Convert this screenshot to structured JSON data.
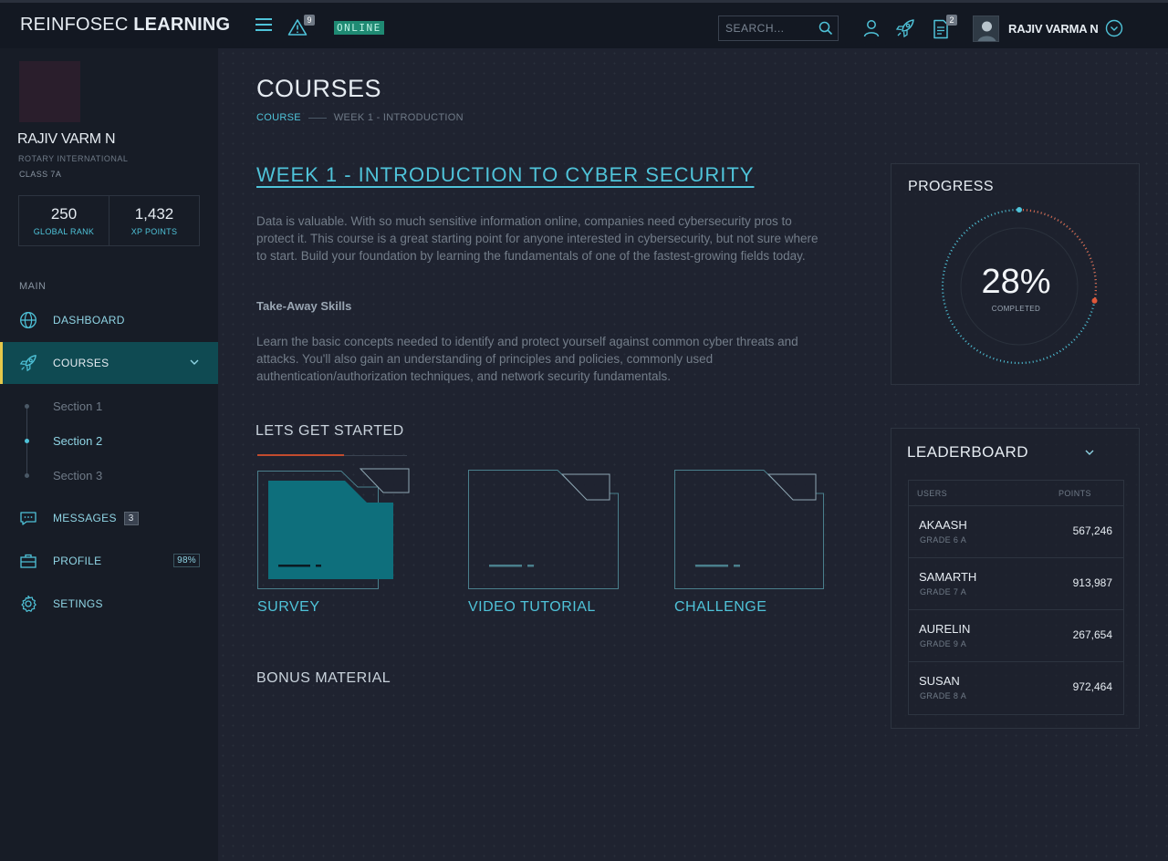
{
  "brand": {
    "name_light": "REINFOSEC ",
    "name_bold": "LEARNING"
  },
  "topbar": {
    "alerts_count": "9",
    "status": "ONLINE",
    "search_placeholder": "SEARCH...",
    "docs_count": "2",
    "user_name": "RAJIV VARMA N"
  },
  "sidebar": {
    "profile": {
      "name": "RAJIV VARM N",
      "school": "ROTARY INTERNATIONAL",
      "class": "CLASS 7A",
      "rank_value": "250",
      "rank_label": "GLOBAL RANK",
      "xp_value": "1,432",
      "xp_label": "XP POINTS"
    },
    "section_label": "MAIN",
    "nav": {
      "dashboard": "DASHBOARD",
      "courses": "COURSES",
      "messages": "MESSAGES",
      "messages_count": "3",
      "profile": "PROFILE",
      "profile_pct": "98%",
      "settings": "SETINGS"
    },
    "sections": [
      "Section 1",
      "Section 2",
      "Section 3"
    ]
  },
  "main": {
    "page_title": "COURSES",
    "breadcrumb": {
      "root": "COURSE",
      "current": "WEEK 1 - INTRODUCTION"
    },
    "week_title": "WEEK 1 - INTRODUCTION TO CYBER SECURITY",
    "description": "Data is valuable. With so much sensitive information online, companies need cybersecurity pros to protect it. This course is a great starting point for anyone interested in cybersecurity, but not sure where to start. Build your foundation by learning the fundamentals of one of the fastest-growing fields today.",
    "takeaway_title": "Take-Away Skills",
    "takeaway_text": "Learn the basic concepts needed to identify and protect yourself against common cyber threats and attacks. You'll also gain an understanding of principles and policies, commonly used authentication/authorization techniques, and network security fundamentals.",
    "start_heading": "LETS GET STARTED",
    "cards": [
      "SURVEY",
      "VIDEO TUTORIAL",
      "CHALLENGE"
    ],
    "bonus_heading": "BONUS MATERIAL"
  },
  "progress": {
    "title": "PROGRESS",
    "value_text": "28%",
    "value_fraction": 0.28,
    "label": "COMPLETED"
  },
  "leaderboard": {
    "title": "LEADERBOARD",
    "col_users": "USERS",
    "col_points": "POINTS",
    "rows": [
      {
        "name": "AKAASH",
        "grade": "GRADE 6 A",
        "points": "567,246"
      },
      {
        "name": "SAMARTH",
        "grade": "GRADE 7 A",
        "points": "913,987"
      },
      {
        "name": "AURELIN",
        "grade": "GRADE 9 A",
        "points": "267,654"
      },
      {
        "name": "SUSAN",
        "grade": "GRADE 8 A",
        "points": "972,464"
      }
    ]
  },
  "colors": {
    "accent": "#4fc3d9",
    "active_bg": "#0f4a52",
    "active_border": "#e5c84a",
    "progress_done": "#e0583a",
    "progress_remaining": "#4fc3d9",
    "online_bg": "#1f8a73"
  },
  "icons": {
    "menu": "hamburger-icon",
    "alert": "warning-icon",
    "search": "search-icon",
    "user": "user-icon",
    "rocket": "rocket-icon",
    "doc": "document-icon",
    "chevron": "chevron-down-circle-icon",
    "globe": "globe-icon",
    "chat": "chat-icon",
    "briefcase": "briefcase-icon",
    "gear": "gear-icon"
  }
}
